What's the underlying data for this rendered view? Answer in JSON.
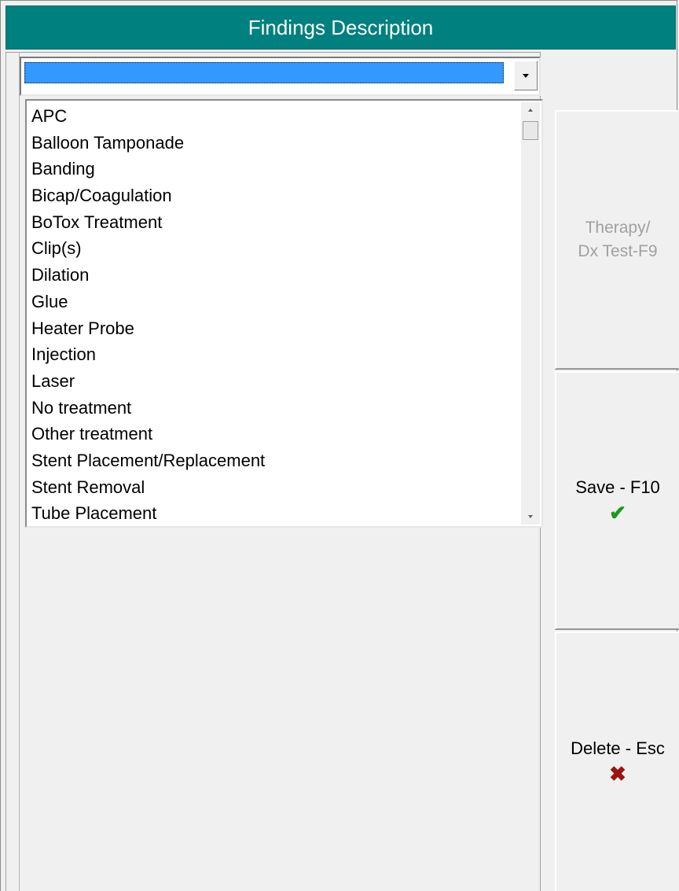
{
  "window": {
    "title": "Findings Description"
  },
  "combo": {
    "selected_value": ""
  },
  "list": {
    "items": [
      "APC",
      "Balloon Tamponade",
      "Banding",
      "Bicap/Coagulation",
      "BoTox Treatment",
      "Clip(s)",
      "Dilation",
      "Glue",
      "Heater Probe",
      "Injection",
      "Laser",
      "No treatment",
      "Other treatment",
      "Stent Placement/Replacement",
      "Stent Removal",
      "Tube Placement"
    ]
  },
  "buttons": {
    "therapy_line1": "Therapy/",
    "therapy_line2": "Dx Test-F9",
    "save_label": "Save - F10",
    "delete_label": "Delete - Esc"
  },
  "icons": {
    "save": "checkmark-icon",
    "delete": "x-icon",
    "combo_dropdown": "chevron-down-icon"
  },
  "colors": {
    "title_bar": "#00807f",
    "selection": "#3399ff",
    "save_icon": "#1a9a1a",
    "delete_icon": "#9a1414"
  }
}
